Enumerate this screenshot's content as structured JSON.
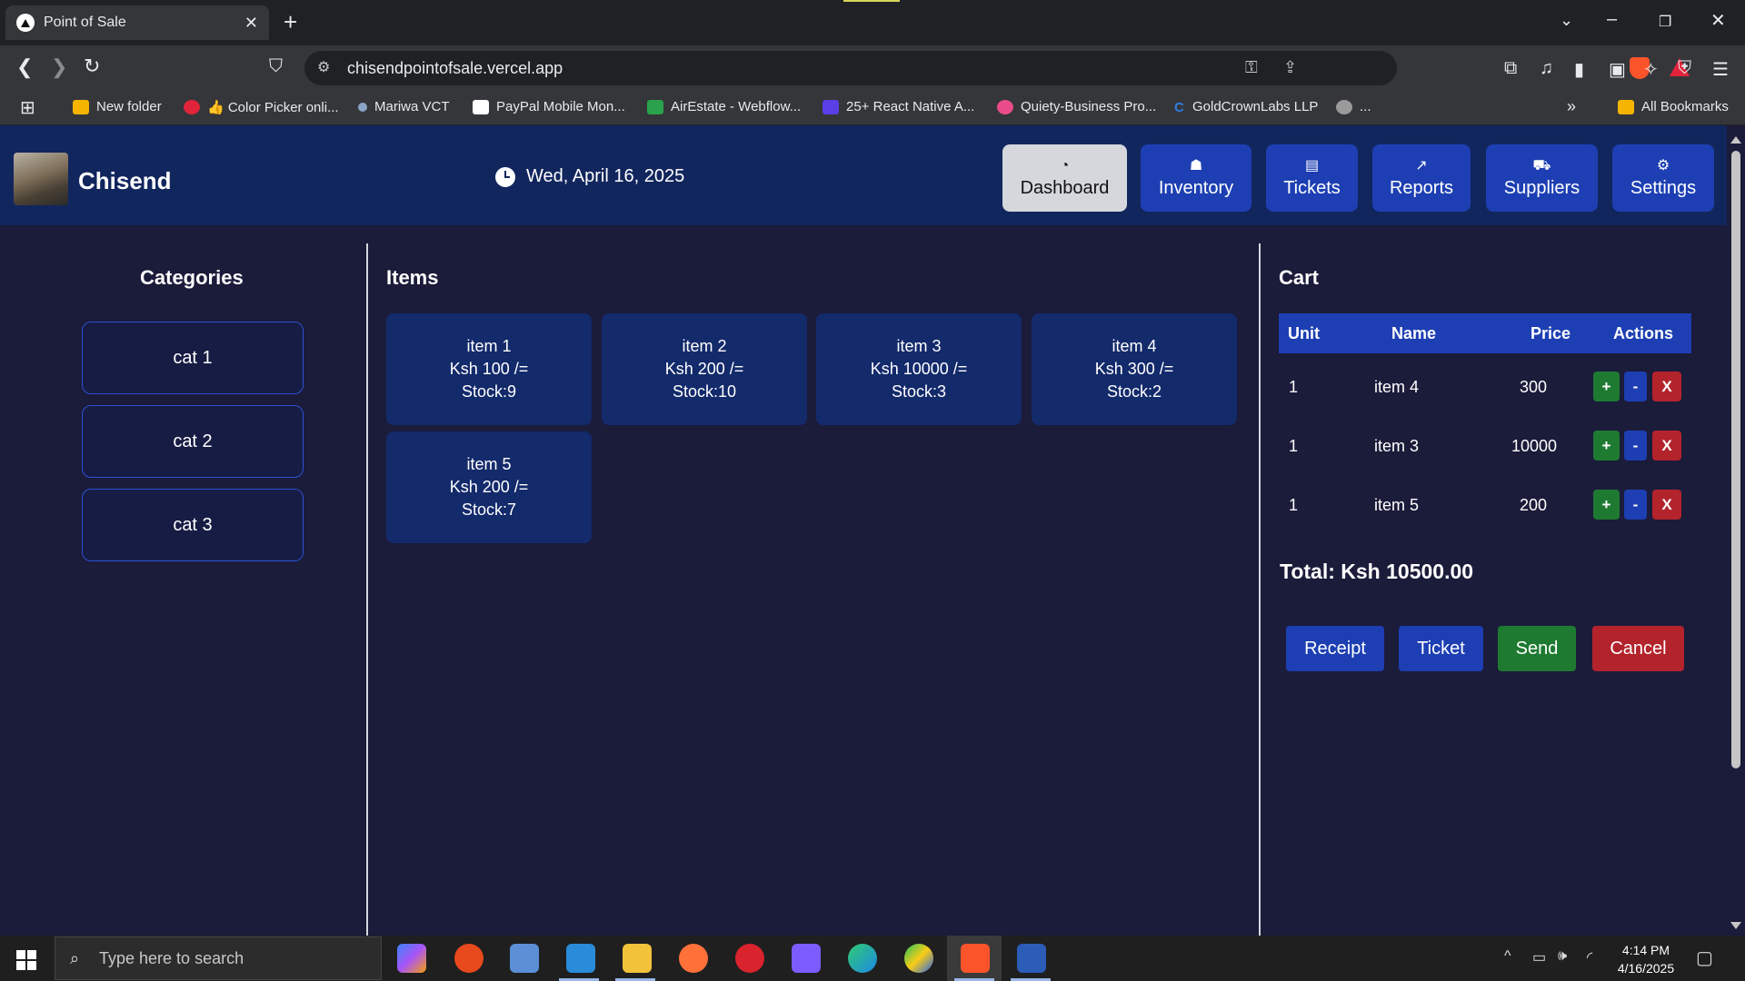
{
  "browser": {
    "tab_title": "Point of Sale",
    "url": "chisendpointofsale.vercel.app",
    "bookmarks": [
      {
        "label": "New folder",
        "icon": "folder-icon"
      },
      {
        "label": "👍 Color Picker onli...",
        "icon": "color-picker-icon"
      },
      {
        "label": "Mariwa VCT",
        "icon": "mariwa-icon"
      },
      {
        "label": "PayPal Mobile Mon...",
        "icon": "paypal-icon"
      },
      {
        "label": "AirEstate - Webflow...",
        "icon": "airestate-icon"
      },
      {
        "label": "25+ React Native A...",
        "icon": "rocket-icon"
      },
      {
        "label": "Quiety-Business Pro...",
        "icon": "dribbble-icon"
      },
      {
        "label": "GoldCrownLabs LLP",
        "icon": "goldcrown-icon"
      },
      {
        "label": "...",
        "icon": "globe-icon"
      }
    ],
    "all_bookmarks": "All Bookmarks",
    "overflow": "»"
  },
  "app": {
    "brand": "Chisend",
    "date": "Wed, April 16, 2025",
    "nav": [
      {
        "label": "Dashboard",
        "icon": "◔"
      },
      {
        "label": "Inventory",
        "icon": "☗"
      },
      {
        "label": "Tickets",
        "icon": "▤"
      },
      {
        "label": "Reports",
        "icon": "↗"
      },
      {
        "label": "Suppliers",
        "icon": "⛟"
      },
      {
        "label": "Settings",
        "icon": "⚙"
      }
    ],
    "categories_title": "Categories",
    "categories": [
      "cat 1",
      "cat 2",
      "cat 3"
    ],
    "items_title": "Items",
    "items": [
      {
        "name": "item 1",
        "price": "Ksh 100 /=",
        "stock": "Stock:9"
      },
      {
        "name": "item 2",
        "price": "Ksh 200 /=",
        "stock": "Stock:10"
      },
      {
        "name": "item 3",
        "price": "Ksh 10000 /=",
        "stock": "Stock:3"
      },
      {
        "name": "item 4",
        "price": "Ksh 300 /=",
        "stock": "Stock:2"
      },
      {
        "name": "item 5",
        "price": "Ksh 200 /=",
        "stock": "Stock:7"
      }
    ],
    "cart_title": "Cart",
    "cart_columns": [
      "Unit",
      "Name",
      "Price",
      "Actions"
    ],
    "cart_rows": [
      {
        "unit": "1",
        "name": "item 4",
        "price": "300"
      },
      {
        "unit": "1",
        "name": "item 3",
        "price": "10000"
      },
      {
        "unit": "1",
        "name": "item 5",
        "price": "200"
      }
    ],
    "action_labels": {
      "plus": "+",
      "minus": "-",
      "remove": "X"
    },
    "total": "Total: Ksh 10500.00",
    "buttons": {
      "receipt": "Receipt",
      "ticket": "Ticket",
      "send": "Send",
      "cancel": "Cancel"
    },
    "colors": {
      "header": "#12265e",
      "page": "#1b1b3a",
      "primary": "#1d3fb3",
      "success": "#1e7a31",
      "danger": "#b3232c"
    }
  },
  "taskbar": {
    "search_placeholder": "Type here to search",
    "time": "4:14 PM",
    "date": "4/16/2025"
  }
}
